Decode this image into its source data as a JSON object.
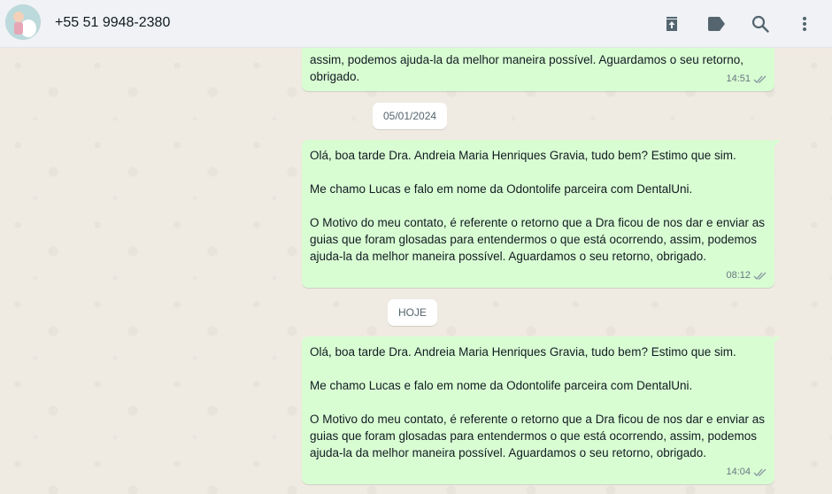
{
  "header": {
    "contact_name": "+55 51 9948-2380",
    "icons": [
      "avatar",
      "archive-icon",
      "label-icon",
      "search-icon",
      "menu-icon"
    ]
  },
  "messages": [
    {
      "text": "assim, podemos ajuda-la da melhor maneira possível. Aguardamos o seu retorno, obrigado.",
      "time": "14:51",
      "status": "read"
    },
    {
      "text": "Olá, boa tarde Dra. Andreia Maria Henriques Gravia, tudo bem? Estimo que sim.\n\nMe chamo Lucas e falo em nome da Odontolife parceira com DentalUni.\n\nO Motivo do meu contato, é referente o retorno que a Dra ficou de nos dar e enviar as guias que foram glosadas para entendermos o que está ocorrendo, assim, podemos ajuda-la da melhor maneira possível. Aguardamos o seu retorno, obrigado.",
      "time": "08:12",
      "status": "read"
    },
    {
      "text": "Olá, boa tarde Dra. Andreia Maria Henriques Gravia, tudo bem? Estimo que sim.\n\nMe chamo Lucas e falo em nome da Odontolife parceira com DentalUni.\n\nO Motivo do meu contato, é referente o retorno que a Dra ficou de nos dar e enviar as guias que foram glosadas para entendermos o que está ocorrendo, assim, podemos ajuda-la da melhor maneira possível. Aguardamos o seu retorno, obrigado.",
      "time": "14:04",
      "status": "read"
    }
  ],
  "date_chips": [
    "05/01/2024",
    "HOJE"
  ],
  "colors": {
    "outgoing_bubble": "#d9fdd3",
    "chat_background": "#efeae2",
    "header_background": "#f0f2f5",
    "read_ticks": "#8696a0"
  }
}
